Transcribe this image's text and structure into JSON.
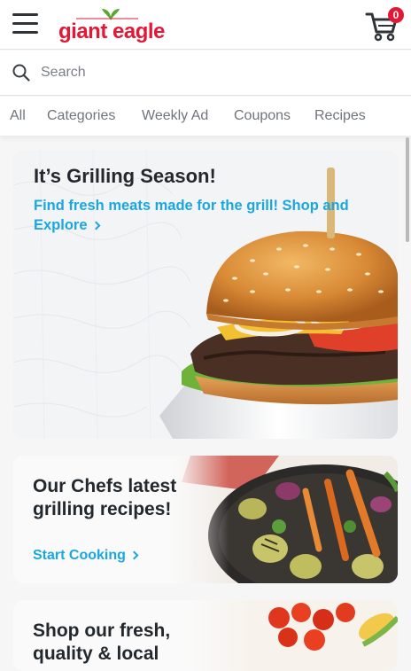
{
  "header": {
    "logo_text": "giant eagle",
    "cart_count": "0",
    "brand_color": "#e31837"
  },
  "search": {
    "placeholder": "Search"
  },
  "nav": {
    "items": [
      "All",
      "Categories",
      "Weekly Ad",
      "Coupons",
      "Recipes"
    ]
  },
  "hero": {
    "title": "It’s Grilling Season!",
    "subtitle": "Find fresh meats made for the grill! Shop and",
    "link": "Explore"
  },
  "chefs": {
    "title": "Our Chefs latest grilling recipes!",
    "link": "Start Cooking"
  },
  "produce": {
    "title": "Shop our fresh, quality & local"
  },
  "colors": {
    "accent": "#1aa7e1",
    "text": "#23282d"
  }
}
